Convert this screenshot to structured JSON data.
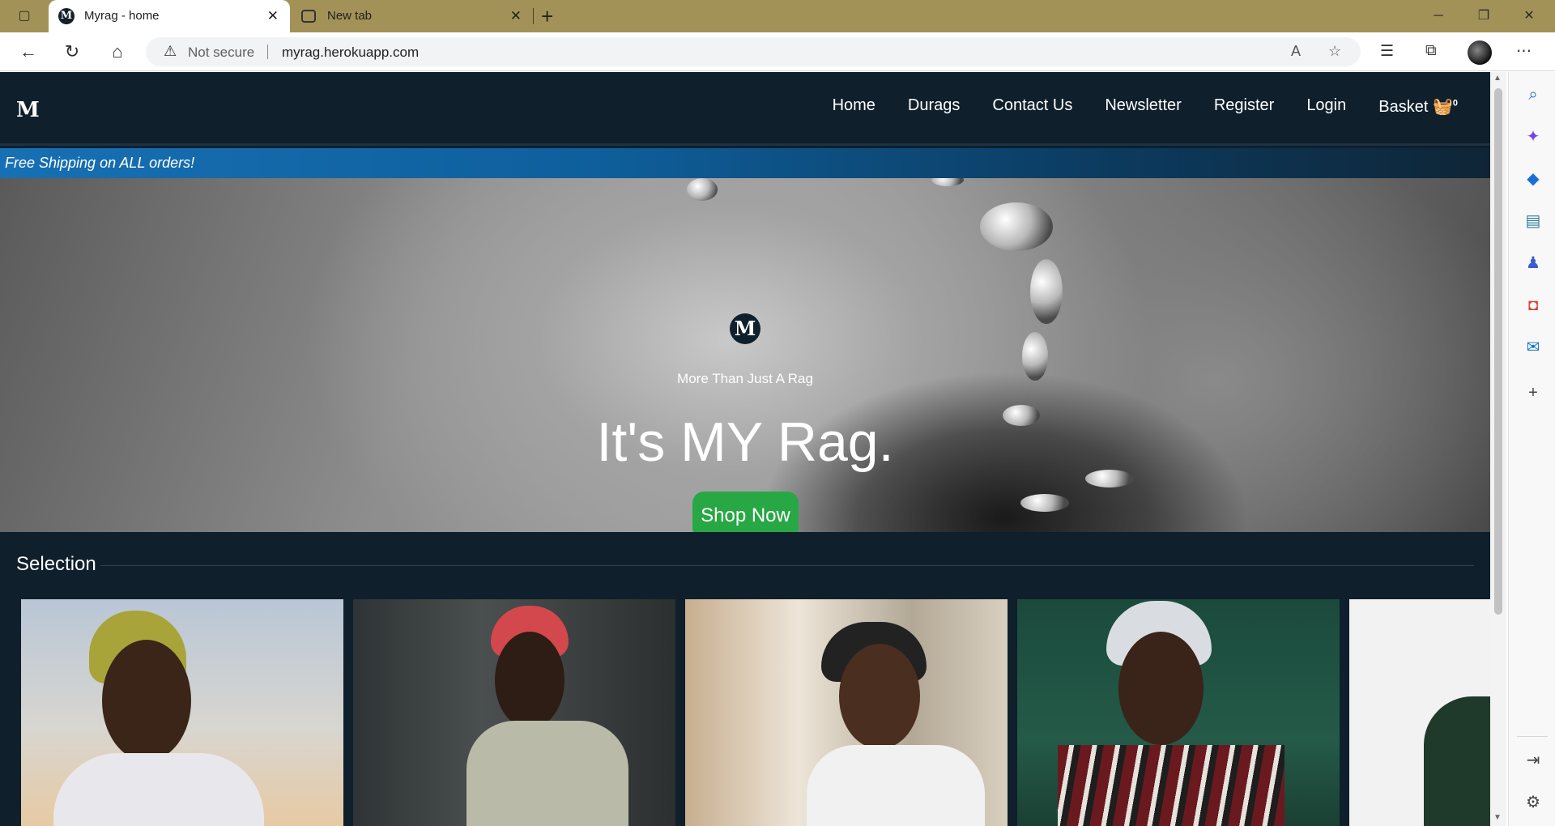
{
  "browser": {
    "tabs": [
      {
        "title": "Myrag - home",
        "active": true
      },
      {
        "title": "New tab",
        "active": false
      }
    ],
    "security_label": "Not secure",
    "url": "myrag.herokuapp.com"
  },
  "site": {
    "logo": "M",
    "nav": [
      {
        "label": "Home"
      },
      {
        "label": "Durags"
      },
      {
        "label": "Contact Us"
      },
      {
        "label": "Newsletter"
      },
      {
        "label": "Register"
      },
      {
        "label": "Login"
      }
    ],
    "basket": {
      "label": "Basket",
      "count": "0"
    },
    "shipping_banner": "Free Shipping on ALL orders!",
    "hero": {
      "logo": "M",
      "subtitle": "More Than Just A Rag",
      "title": "It's MY Rag.",
      "cta": "Shop Now"
    },
    "selection": {
      "heading": "Selection",
      "cards": [
        {
          "name": "yellow-durag-photo"
        },
        {
          "name": "red-durag-photo"
        },
        {
          "name": "black-durag-photo"
        },
        {
          "name": "white-durag-photo"
        },
        {
          "name": "green-durag-photo"
        }
      ]
    }
  },
  "icons": {
    "read_aloud": "read-aloud-icon",
    "favorites_add": "add-favorite-icon",
    "favorites": "favorites-icon",
    "collections": "collections-icon",
    "more": "more-icon"
  }
}
